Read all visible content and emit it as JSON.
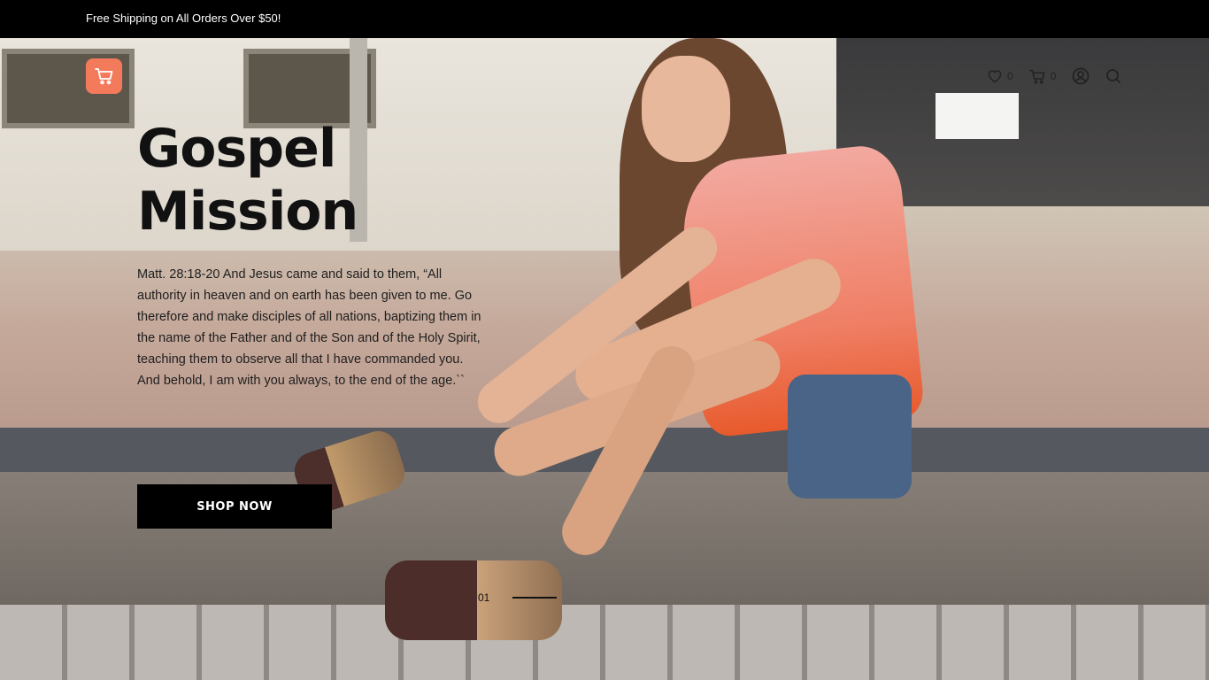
{
  "topbar": {
    "text": "Free Shipping on All Orders Over $50!"
  },
  "header": {
    "logo_icon": "cart-icon",
    "icons": [
      {
        "name": "wishlist-icon",
        "count": "0"
      },
      {
        "name": "cart-icon",
        "count": "0"
      },
      {
        "name": "account-icon"
      },
      {
        "name": "search-icon"
      }
    ]
  },
  "hero": {
    "title_line1": "Gospel",
    "title_line2": "Mission",
    "verse": "Matt. 28:18-20 And Jesus came and said to them, “All authority in heaven and on earth has been given to me. Go therefore and make disciples of all nations, baptizing them in the name of the Father and of the Son and of the Holy Spirit, teaching them to observe all that I have commanded you. And behold, I am with you always, to the end of the age.``",
    "button_label": "SHOP NOW",
    "slide_number": "01"
  },
  "colors": {
    "accent": "#f47a5c",
    "topbar": "#000000",
    "button": "#000000"
  }
}
